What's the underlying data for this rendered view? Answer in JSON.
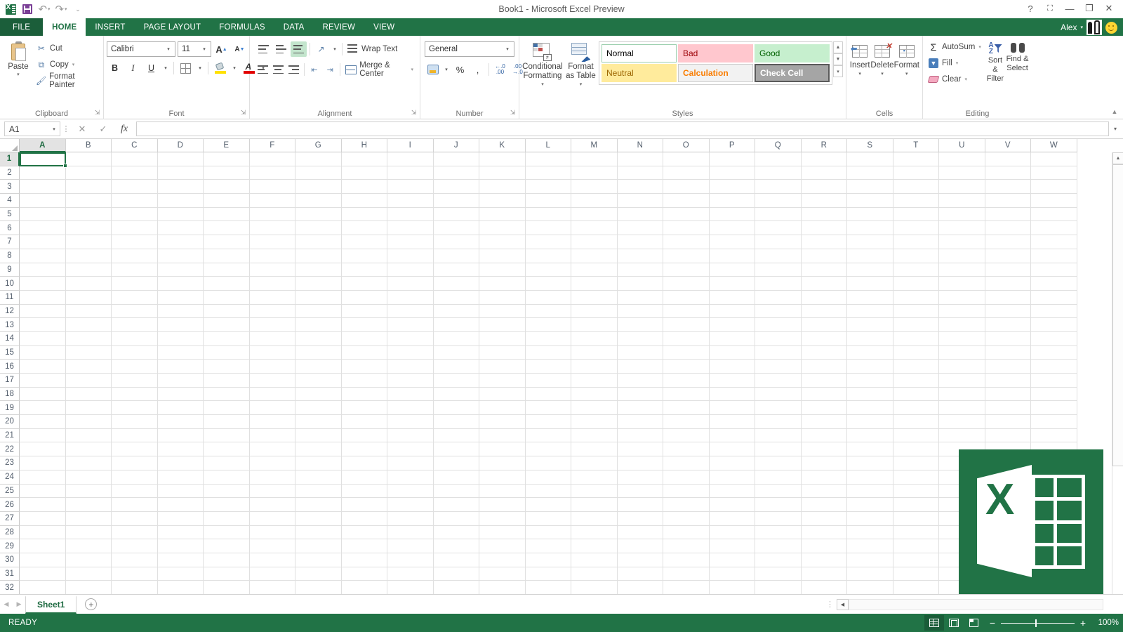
{
  "titlebar": {
    "document_title": "Book1 - Microsoft Excel Preview",
    "qat": [
      {
        "name": "excel-icon",
        "label": "Excel"
      },
      {
        "name": "save-icon",
        "label": "Save"
      },
      {
        "name": "undo-icon",
        "label": "Undo",
        "glyph": "↶"
      },
      {
        "name": "redo-icon",
        "label": "Redo",
        "glyph": "↷"
      },
      {
        "name": "customize-qat-icon",
        "label": "Customize Quick Access Toolbar",
        "glyph": "⌄"
      }
    ],
    "window_controls": [
      {
        "name": "help-button",
        "glyph": "?"
      },
      {
        "name": "ribbon-display-options-button",
        "glyph": "⛶"
      },
      {
        "name": "minimize-button",
        "glyph": "—"
      },
      {
        "name": "restore-button",
        "glyph": "❐"
      },
      {
        "name": "close-button",
        "glyph": "✕"
      }
    ]
  },
  "ribbon_tabs": {
    "file": "FILE",
    "tabs": [
      "HOME",
      "INSERT",
      "PAGE LAYOUT",
      "FORMULAS",
      "DATA",
      "REVIEW",
      "VIEW"
    ],
    "active": "HOME"
  },
  "account": {
    "username": "Alex",
    "dropdown_glyph": "▾"
  },
  "ribbon": {
    "clipboard": {
      "group_label": "Clipboard",
      "paste": "Paste",
      "cut": "Cut",
      "copy": "Copy",
      "format_painter": "Format Painter"
    },
    "font": {
      "group_label": "Font",
      "font_name": "Calibri",
      "font_size": "11",
      "bold": "B",
      "italic": "I",
      "underline": "U",
      "grow_font": "A",
      "shrink_font": "A",
      "fill_color_a": "A"
    },
    "alignment": {
      "group_label": "Alignment",
      "wrap_text": "Wrap Text",
      "merge_center": "Merge & Center"
    },
    "number": {
      "group_label": "Number",
      "format": "General",
      "percent": "%",
      "comma": ",",
      "increase_decimal": "\u0000",
      "decrease_decimal": "\u0000"
    },
    "styles": {
      "group_label": "Styles",
      "conditional_formatting": "Conditional Formatting",
      "format_as_table": "Format as Table",
      "gallery": [
        {
          "label": "Normal",
          "bg": "#ffffff",
          "color": "#000000",
          "border": "#9ccfae"
        },
        {
          "label": "Bad",
          "bg": "#ffc7ce",
          "color": "#9c0006",
          "border": "#ffc7ce"
        },
        {
          "label": "Good",
          "bg": "#c6efce",
          "color": "#006100",
          "border": "#c6efce"
        },
        {
          "label": "Neutral",
          "bg": "#ffeb9c",
          "color": "#9c6500",
          "border": "#ffeb9c"
        },
        {
          "label": "Calculation",
          "bg": "#f2f2f2",
          "color": "#fa7d00",
          "border": "#cccccc"
        },
        {
          "label": "Check Cell",
          "bg": "#a5a5a5",
          "color": "#ffffff",
          "border": "#5a5a5a"
        }
      ]
    },
    "cells": {
      "group_label": "Cells",
      "insert": "Insert",
      "delete": "Delete",
      "format": "Format"
    },
    "editing": {
      "group_label": "Editing",
      "autosum": "AutoSum",
      "fill": "Fill",
      "clear": "Clear",
      "sort_filter": "Sort & Filter",
      "find_select": "Find & Select",
      "sigma": "Σ"
    }
  },
  "formula_bar": {
    "name_box": "A1",
    "cancel_glyph": "✕",
    "enter_glyph": "✓",
    "fx": "fx",
    "value": "",
    "placeholder": ""
  },
  "grid": {
    "columns": [
      "A",
      "B",
      "C",
      "D",
      "E",
      "F",
      "G",
      "H",
      "I",
      "J",
      "K",
      "L",
      "M",
      "N",
      "O",
      "P",
      "Q",
      "R",
      "S",
      "T",
      "U",
      "V",
      "W"
    ],
    "rows": [
      1,
      2,
      3,
      4,
      5,
      6,
      7,
      8,
      9,
      10,
      11,
      12,
      13,
      14,
      15,
      16,
      17,
      18,
      19,
      20,
      21,
      22,
      23,
      24,
      25,
      26,
      27,
      28,
      29,
      30,
      31,
      32
    ],
    "selected_cell": "A1",
    "selected_column": "A",
    "selected_row": 1
  },
  "sheet_tabs": {
    "sheets": [
      "Sheet1"
    ],
    "active": "Sheet1",
    "add_sheet_glyph": "+",
    "prev_glyph": "◀",
    "next_glyph": "▶"
  },
  "status_bar": {
    "state": "READY",
    "views": [
      {
        "name": "normal-view-button",
        "label": "Normal",
        "active": true
      },
      {
        "name": "page-layout-view-button",
        "label": "Page Layout",
        "active": false
      },
      {
        "name": "page-break-preview-button",
        "label": "Page Break Preview",
        "active": false
      }
    ],
    "zoom_out": "−",
    "zoom_in": "+",
    "zoom_level": "100%"
  },
  "colors": {
    "excel_green": "#217346",
    "dark_green": "#1b5e3a",
    "status_green": "#217346"
  },
  "watermark": {
    "letter": "X"
  }
}
